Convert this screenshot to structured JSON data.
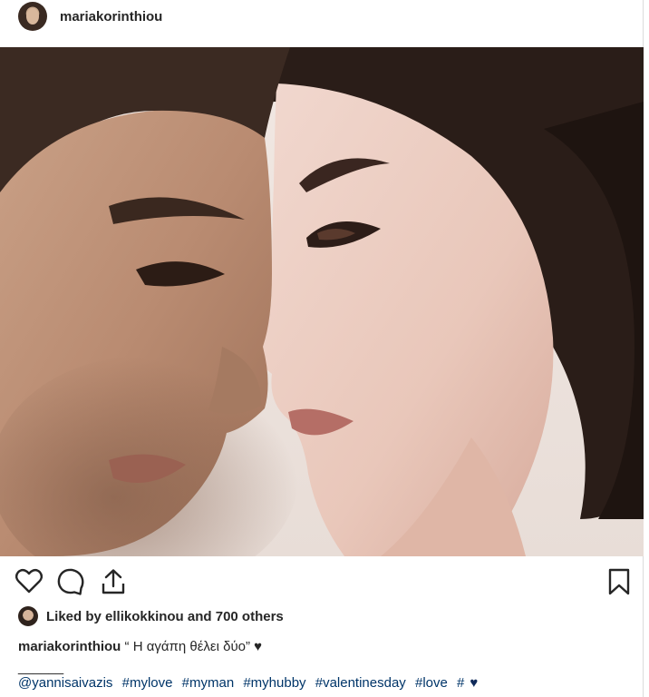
{
  "post": {
    "username": "mariakorinthiou",
    "likes": {
      "prefix": "Liked by ",
      "user": "ellikokkinou",
      "suffix": " and 700 others"
    },
    "caption": {
      "username": "mariakorinthiou",
      "text": " “ Η αγάπη θέλει δύο” ",
      "heart": "♥"
    },
    "separator": "______",
    "mention": "@yannisaivazis",
    "hashtags": [
      "#mylove",
      "#myman",
      "#myhubby",
      "#valentinesday",
      "#love"
    ],
    "tail_tag": "#",
    "tail_heart": "♥"
  },
  "colors": {
    "tag_blue": "#003569",
    "heart_navy": "#0f2a5a",
    "text": "#262626"
  },
  "icons": {
    "like": "heart-outline-icon",
    "comment": "comment-bubble-icon",
    "share": "share-upload-icon",
    "save": "bookmark-icon"
  }
}
